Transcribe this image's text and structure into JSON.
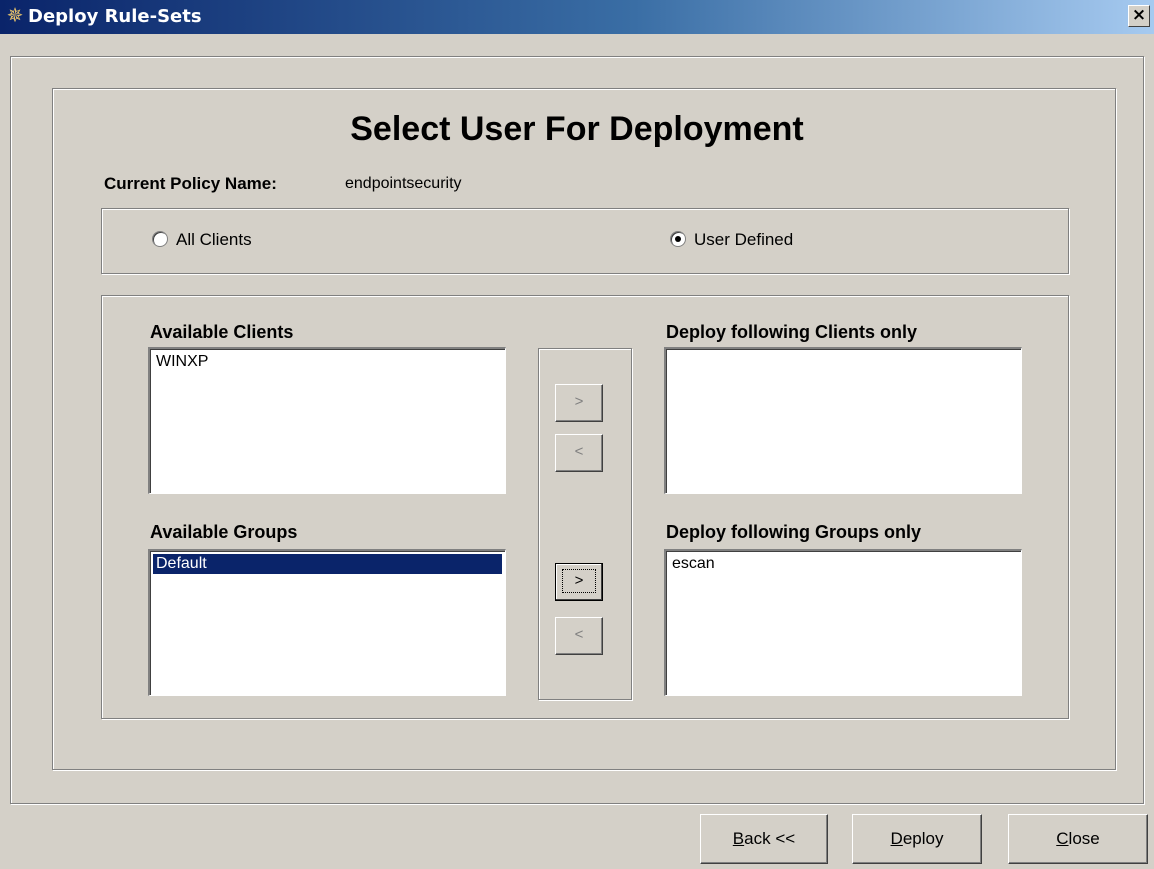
{
  "window": {
    "title": "Deploy Rule-Sets",
    "close_glyph": "×"
  },
  "heading": "Select User For Deployment",
  "policy": {
    "label": "Current Policy Name:",
    "value": "endpointsecurity"
  },
  "deploy_mode": {
    "options": [
      "All Clients",
      "User Defined"
    ],
    "selected": "User Defined"
  },
  "available_clients": {
    "label": "Available Clients",
    "items": [
      "WINXP"
    ]
  },
  "deploy_clients": {
    "label": "Deploy following Clients only",
    "items": []
  },
  "available_groups": {
    "label": "Available Groups",
    "items": [
      "Default"
    ],
    "selected": "Default"
  },
  "deploy_groups": {
    "label": "Deploy following Groups only",
    "items": [
      "escan"
    ]
  },
  "transfer_buttons": {
    "add": ">",
    "remove": "<"
  },
  "footer": {
    "back": {
      "mnemonic": "B",
      "rest": "ack <<"
    },
    "deploy": {
      "mnemonic": "D",
      "rest": "eploy"
    },
    "close": {
      "mnemonic": "C",
      "rest": "lose"
    }
  }
}
